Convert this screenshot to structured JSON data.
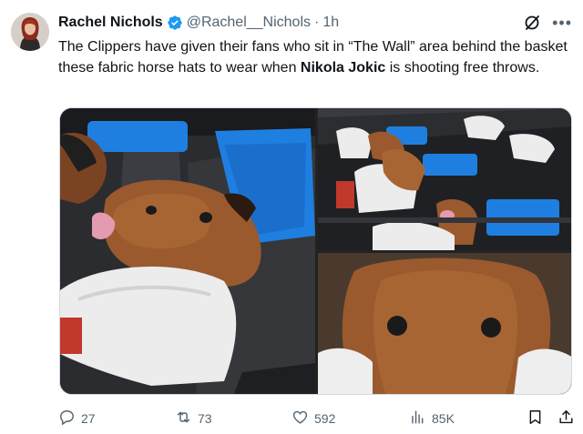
{
  "tweet": {
    "author_name": "Rachel Nichols",
    "handle": "@Rachel__Nichols",
    "separator": "·",
    "time": "1h",
    "text_part1": "The Clippers have given their fans who sit in “The Wall” area behind the basket these fabric horse hats to wear when ",
    "text_bold": "Nikola Jokic",
    "text_part2": " is shooting free throws."
  },
  "actions": {
    "replies": "27",
    "reposts": "73",
    "likes": "592",
    "views": "85K"
  },
  "icons": [
    "verified-badge-icon",
    "grok-icon",
    "more-icon",
    "reply-icon",
    "repost-icon",
    "like-icon",
    "views-icon",
    "bookmark-icon",
    "share-icon"
  ],
  "colors": {
    "text": "#0f1419",
    "secondary": "#536471",
    "verified": "#1d9bf0",
    "seat_blue": "#1f7fe0",
    "horse_brown": "#9a5a2e"
  }
}
